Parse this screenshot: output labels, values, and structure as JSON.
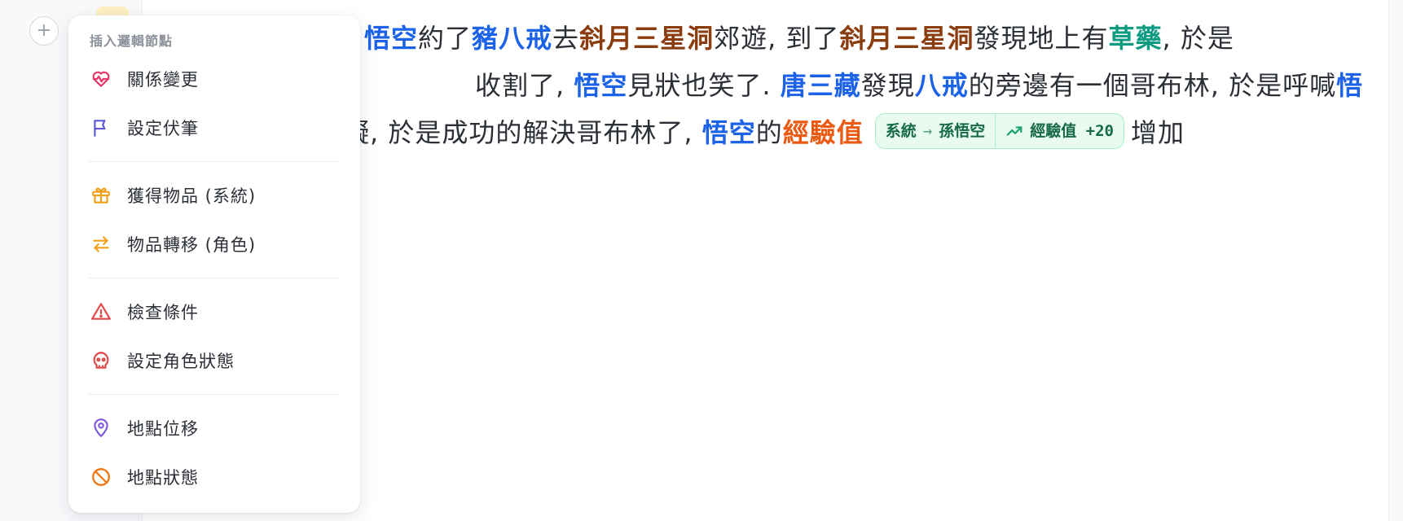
{
  "colors": {
    "character": "#1d63e8",
    "place": "#8a3c0e",
    "item": "#0f9b82",
    "stat": "#ea5a13",
    "chip_bg": "#e9fbf1",
    "chip_text": "#166a45"
  },
  "gutter": {
    "add_button_label": "+"
  },
  "menu": {
    "title": "插入邏輯節點",
    "groups": [
      [
        {
          "label": "關係變更",
          "icon": "heart-pulse-icon",
          "color": "#e8366a"
        },
        {
          "label": "設定伏筆",
          "icon": "flag-icon",
          "color": "#5b57d6"
        }
      ],
      [
        {
          "label": "獲得物品 (系統)",
          "icon": "gift-icon",
          "color": "#f0a11a"
        },
        {
          "label": "物品轉移 (角色)",
          "icon": "swap-arrows-icon",
          "color": "#f0a11a"
        }
      ],
      [
        {
          "label": "檢查條件",
          "icon": "warning-triangle-icon",
          "color": "#e24848"
        },
        {
          "label": "設定角色狀態",
          "icon": "skull-icon",
          "color": "#e24848"
        }
      ],
      [
        {
          "label": "地點位移",
          "icon": "map-pin-icon",
          "color": "#7e57d8"
        },
        {
          "label": "地點狀態",
          "icon": "ban-circle-icon",
          "color": "#f07a1a"
        }
      ]
    ]
  },
  "story": {
    "line1": [
      {
        "t": "悟空",
        "k": "c"
      },
      {
        "t": "約了",
        "k": ""
      },
      {
        "t": "豬八戒",
        "k": "c"
      },
      {
        "t": "去",
        "k": ""
      },
      {
        "t": "斜月三星洞",
        "k": "p"
      },
      {
        "t": "郊遊, 到了",
        "k": ""
      },
      {
        "t": "斜月三星洞",
        "k": "p"
      },
      {
        "t": "發現地上有",
        "k": ""
      },
      {
        "t": "草藥",
        "k": "i"
      },
      {
        "t": ", 於是",
        "k": ""
      }
    ],
    "line2": [
      {
        "t": "收割了, ",
        "k": ""
      },
      {
        "t": "悟空",
        "k": "c"
      },
      {
        "t": "見狀也笑了. ",
        "k": ""
      },
      {
        "t": "唐三藏",
        "k": "c"
      },
      {
        "t": "發現",
        "k": ""
      },
      {
        "t": "八戒",
        "k": "c"
      },
      {
        "t": "的旁邊有一個哥布林, 於是呼喊",
        "k": ""
      },
      {
        "t": "悟",
        "k": "c"
      }
    ],
    "line3_before": [
      {
        "t": "礙, 於是成功的解決哥布林了, ",
        "k": ""
      },
      {
        "t": "悟空",
        "k": "c"
      },
      {
        "t": "的",
        "k": ""
      },
      {
        "t": "經驗值",
        "k": "s"
      }
    ],
    "chip": {
      "from": "系統",
      "arrow": "→",
      "to": "孫悟空",
      "trend_icon": "trending-up-icon",
      "stat_text": "經驗值 +20"
    },
    "line3_after": "增加"
  }
}
